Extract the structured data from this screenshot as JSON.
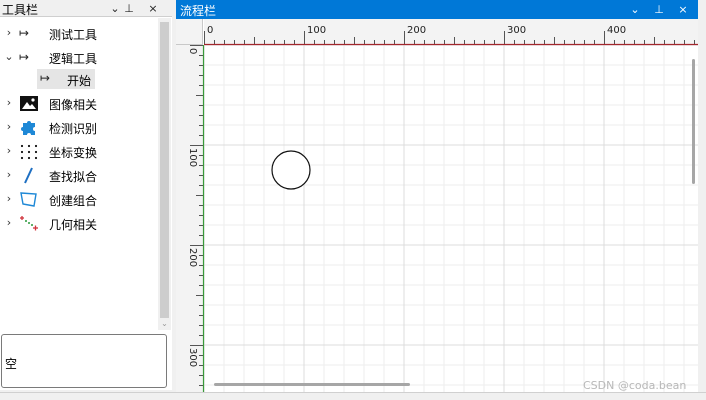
{
  "toolbox": {
    "title": "工具栏",
    "controls": {
      "dropdown": "⌄",
      "pin": "⊥",
      "close": "×"
    },
    "items": [
      {
        "label": "测试工具",
        "icon": "arrow-to-bar-icon",
        "expanded": false
      },
      {
        "label": "逻辑工具",
        "icon": "arrow-to-bar-icon",
        "expanded": true,
        "children": [
          {
            "label": "开始",
            "icon": "arrow-to-bar-icon"
          }
        ]
      },
      {
        "label": "图像相关",
        "icon": "image-icon",
        "expanded": false
      },
      {
        "label": "检测识别",
        "icon": "puzzle-icon",
        "expanded": false
      },
      {
        "label": "坐标变换",
        "icon": "dots-grid-icon",
        "expanded": false
      },
      {
        "label": "查找拟合",
        "icon": "line-fit-icon",
        "expanded": false
      },
      {
        "label": "创建组合",
        "icon": "polygon-icon",
        "expanded": false
      },
      {
        "label": "几何相关",
        "icon": "points-icon",
        "expanded": false
      }
    ],
    "selection_text": "空"
  },
  "flow": {
    "title": "流程栏",
    "controls": {
      "dropdown": "⌄",
      "pin": "⊥",
      "close": "×"
    },
    "ruler": {
      "h_labels": [
        "0",
        "100",
        "200",
        "300",
        "400"
      ],
      "v_labels": [
        "0",
        "100",
        "200",
        "300"
      ]
    },
    "colors": {
      "accent": "#0078d7",
      "h_axis": "#a4262c",
      "v_axis": "#3a9a3a"
    }
  },
  "watermark": "CSDN @coda.bean"
}
